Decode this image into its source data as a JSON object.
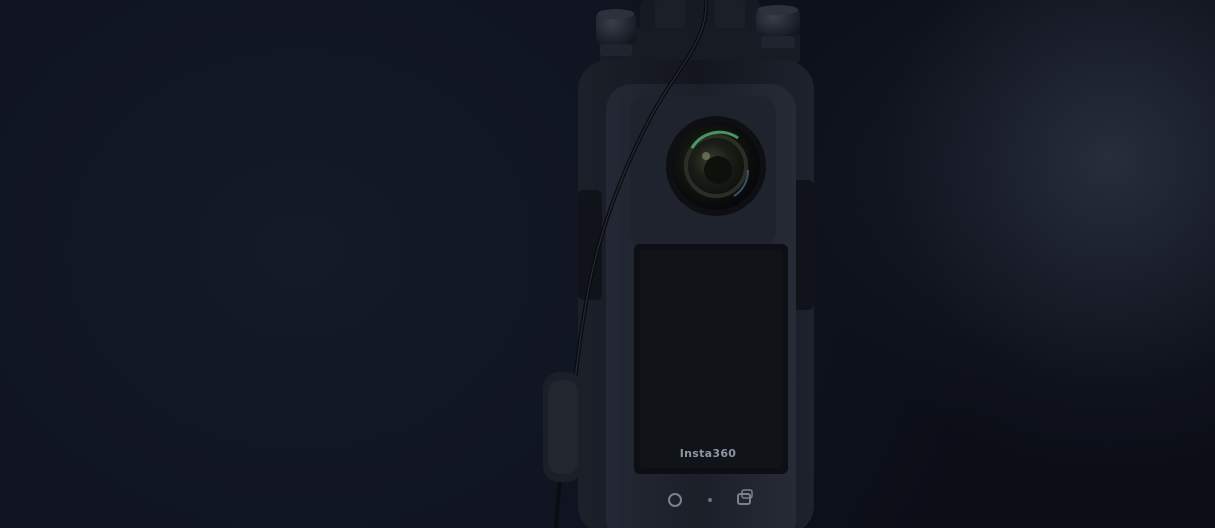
{
  "camera": {
    "brand_label": "Insta360"
  },
  "icons": {
    "left_button": "circle-button-icon",
    "right_button": "switch-button-icon",
    "indicator": "status-dot-icon"
  },
  "colors": {
    "background": "#0e121c",
    "cage": "#151821",
    "camera_body": "#1c2029",
    "screen": "#0d0f14",
    "lens_glint": "#4fae6e",
    "label": "#8d95a3"
  }
}
